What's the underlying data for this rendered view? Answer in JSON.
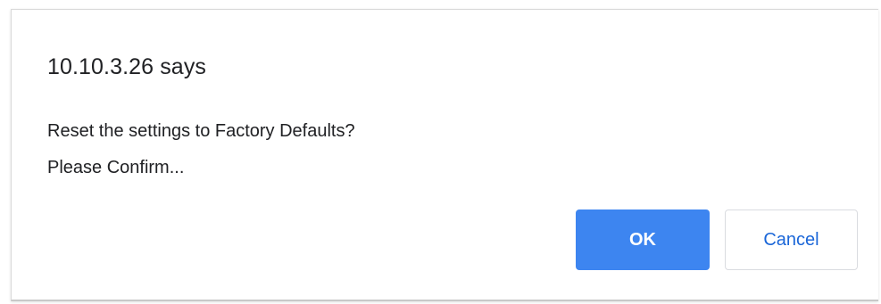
{
  "dialog": {
    "title": "10.10.3.26 says",
    "message_lines": [
      "Reset the settings to Factory Defaults?",
      "Please Confirm..."
    ],
    "buttons": {
      "ok_label": "OK",
      "cancel_label": "Cancel"
    }
  },
  "colors": {
    "ok_button_bg": "#3d85f0",
    "ok_button_text": "#ffffff",
    "cancel_button_text": "#1a66d8",
    "text": "#202124"
  }
}
